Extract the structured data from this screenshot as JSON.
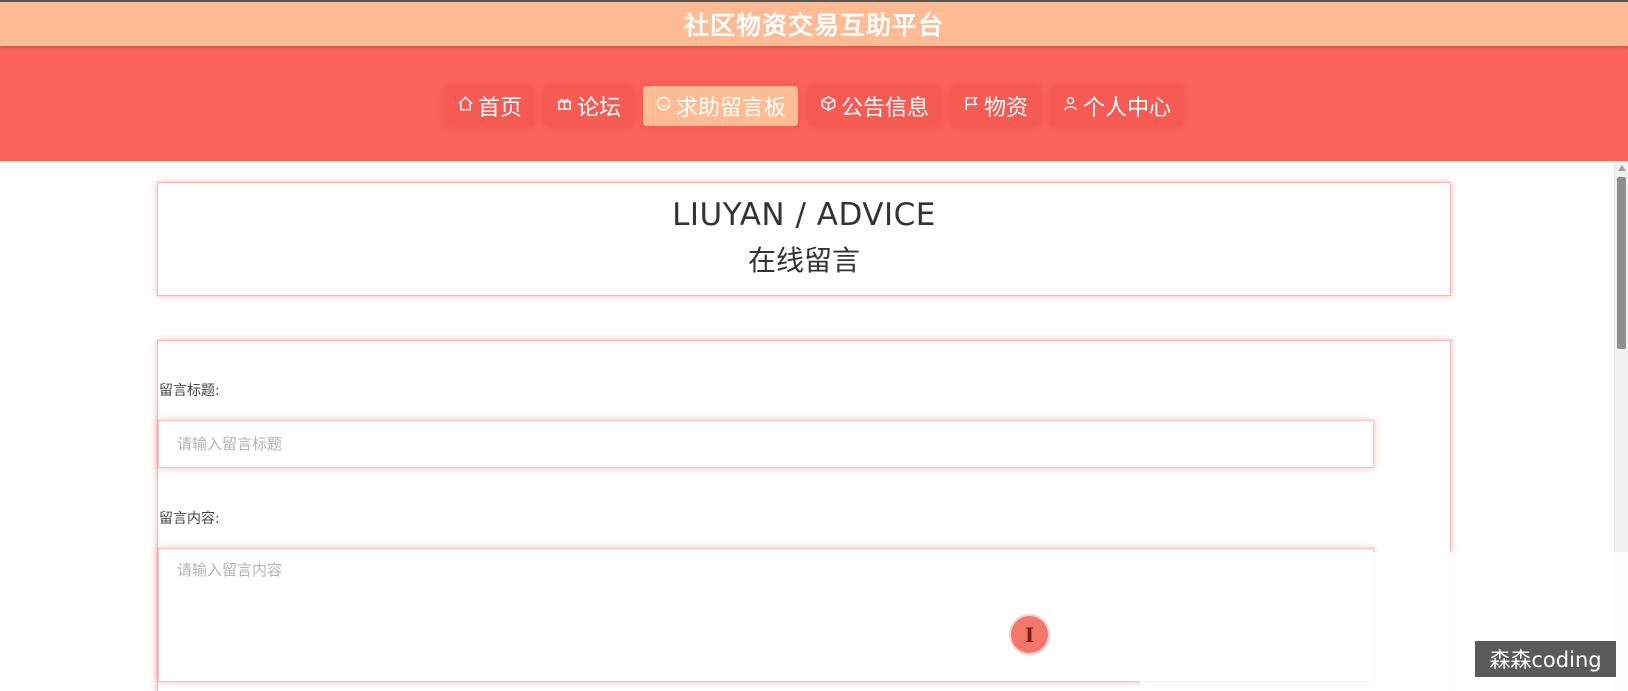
{
  "site": {
    "title": "社区物资交易互助平台"
  },
  "nav": {
    "items": [
      {
        "label": "首页",
        "icon": "home-icon"
      },
      {
        "label": "论坛",
        "icon": "gift-icon"
      },
      {
        "label": "求助留言板",
        "icon": "smile-icon",
        "active": true
      },
      {
        "label": "公告信息",
        "icon": "cube-icon"
      },
      {
        "label": "物资",
        "icon": "flag-icon"
      },
      {
        "label": "个人中心",
        "icon": "user-icon"
      }
    ]
  },
  "header": {
    "en_title": "LIUYAN / ADVICE",
    "cn_title": "在线留言"
  },
  "form": {
    "title_label": "留言标题:",
    "title_placeholder": "请输入留言标题",
    "content_label": "留言内容:",
    "content_placeholder": "请输入留言内容"
  },
  "watermark": "森森coding",
  "colors": {
    "title_bar": "#ffbb93",
    "nav_band": "#fb6259",
    "active_nav": "#ffbb93",
    "card_glow": "#fa6e69"
  }
}
